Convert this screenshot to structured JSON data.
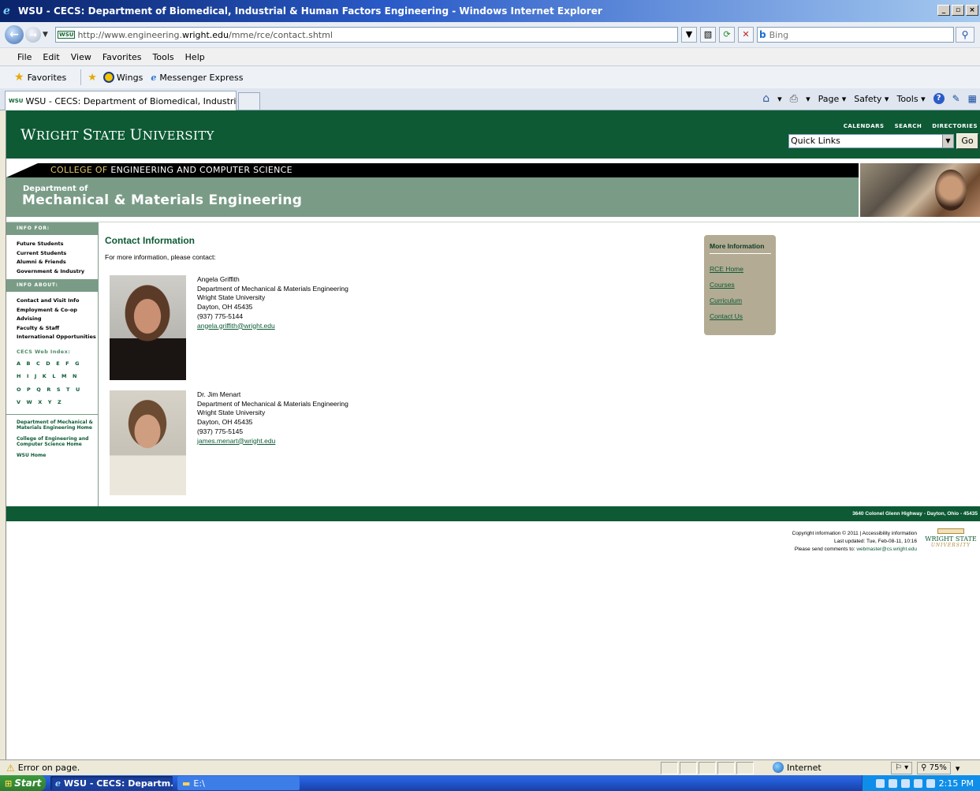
{
  "window": {
    "title": "WSU - CECS: Department of Biomedical, Industrial & Human Factors Engineering - Windows Internet Explorer",
    "controls": [
      "_",
      "▫",
      "×"
    ]
  },
  "address_bar": {
    "favicon_text": "WSU",
    "url_prefix": "http://www.engineering.",
    "url_domain": "wright.edu",
    "url_path": "/mme/rce/contact.shtml",
    "search_placeholder": "Bing"
  },
  "menu": [
    "File",
    "Edit",
    "View",
    "Favorites",
    "Tools",
    "Help"
  ],
  "favorites_bar": {
    "favorites_label": "Favorites",
    "items": [
      "Wings",
      "Messenger Express"
    ]
  },
  "tabs": [
    {
      "favicon_text": "WSU",
      "label": "WSU - CECS: Department of Biomedical, Industrial & ..."
    }
  ],
  "command_bar": {
    "page": "Page ▾",
    "safety": "Safety ▾",
    "tools": "Tools ▾"
  },
  "site": {
    "logo_first": "W",
    "logo_rest": "RIGHT ",
    "logo_s": "S",
    "logo_tate": "TATE ",
    "logo_u": "U",
    "logo_niversity": "NIVERSITY",
    "header_links": [
      "CALENDARS",
      "SEARCH",
      "DIRECTORIES"
    ],
    "quick_links_value": "Quick Links",
    "go_label": "Go",
    "college_of": "COLLEGE OF",
    "college_name": "ENGINEERING AND COMPUTER SCIENCE",
    "dept_small": "Department of",
    "dept_big": "Mechanical & Materials Engineering"
  },
  "sidebar": {
    "info_for_heading": "INFO FOR:",
    "info_for": [
      "Future Students",
      "Current Students",
      "Alumni & Friends",
      "Government & Industry"
    ],
    "info_about_heading": "INFO ABOUT:",
    "info_about": [
      "Contact and Visit Info",
      "Employment & Co-op",
      "Advising",
      "Faculty & Staff",
      "International Opportunities"
    ],
    "web_index_title": "CECS Web Index:",
    "index_rows": [
      [
        "A",
        "B",
        "C",
        "D",
        "E",
        "F",
        "G"
      ],
      [
        "H",
        "I",
        "J",
        "K",
        "L",
        "M",
        "N"
      ],
      [
        "O",
        "P",
        "Q",
        "R",
        "S",
        "T",
        "U"
      ],
      [
        "V",
        "W",
        "X",
        "Y",
        "Z"
      ]
    ],
    "home_links": [
      "Department of Mechanical & Materials Engineering Home",
      "College of Engineering and Computer Science Home",
      "WSU Home"
    ]
  },
  "content": {
    "heading": "Contact Information",
    "intro": "For more information, please contact:",
    "contacts": [
      {
        "name": "Angela Griffith",
        "department": "Department of Mechanical & Materials Engineering",
        "university": "Wright State University",
        "city": "Dayton, OH 45435",
        "phone": "(937) 775-5144",
        "email": "angela.griffith@wright.edu"
      },
      {
        "name": "Dr. Jim Menart",
        "department": "Department of Mechanical & Materials Engineering",
        "university": "Wright State University",
        "city": "Dayton, OH 45435",
        "phone": "(937) 775-5145",
        "email": "james.menart@wright.edu"
      }
    ]
  },
  "more_info": {
    "heading": "More Information",
    "links": [
      "RCE Home",
      "Courses",
      "Curriculum",
      "Contact Us"
    ]
  },
  "footer": {
    "address": "3640 Colonel Glenn Highway - Dayton, Ohio - 45435",
    "copyright": "Copyright information © 2011 | Accessibility information",
    "updated": "Last updated: Tue, Feb-08-11, 10:16",
    "comments_prefix": "Please send comments to: ",
    "comments_email": "webmaster@cs.wright.edu",
    "logo_line1": "WRIGHT STATE",
    "logo_line2": "UNIVERSITY"
  },
  "status_bar": {
    "message": "Error on page.",
    "zone": "Internet",
    "zoom": "75%"
  },
  "taskbar": {
    "start": "Start",
    "buttons": [
      "WSU - CECS: Departm...",
      "E:\\"
    ],
    "clock": "2:15 PM"
  }
}
